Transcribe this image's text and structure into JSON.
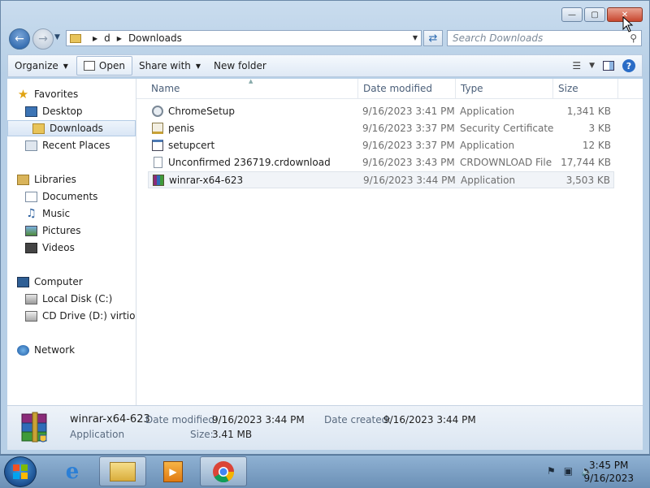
{
  "address": {
    "crumbs": [
      "d",
      "Downloads"
    ]
  },
  "search": {
    "placeholder": "Search Downloads"
  },
  "toolbar": {
    "organize": "Organize",
    "open": "Open",
    "share_with": "Share with",
    "new_folder": "New folder"
  },
  "nav": {
    "favorites": "Favorites",
    "desktop": "Desktop",
    "downloads": "Downloads",
    "recent_places": "Recent Places",
    "libraries": "Libraries",
    "documents": "Documents",
    "music": "Music",
    "pictures": "Pictures",
    "videos": "Videos",
    "computer": "Computer",
    "local_disk": "Local Disk (C:)",
    "cd_drive": "CD Drive (D:) virtio-w",
    "network": "Network"
  },
  "columns": {
    "name": "Name",
    "date": "Date modified",
    "type": "Type",
    "size": "Size"
  },
  "files": [
    {
      "name": "ChromeSetup",
      "date": "9/16/2023 3:41 PM",
      "type": "Application",
      "size": "1,341 KB",
      "icon": "chrome-setup-icon"
    },
    {
      "name": "penis",
      "date": "9/16/2023 3:37 PM",
      "type": "Security Certificate",
      "size": "3 KB",
      "icon": "certificate-icon"
    },
    {
      "name": "setupcert",
      "date": "9/16/2023 3:37 PM",
      "type": "Application",
      "size": "12 KB",
      "icon": "application-icon"
    },
    {
      "name": "Unconfirmed 236719.crdownload",
      "date": "9/16/2023 3:43 PM",
      "type": "CRDOWNLOAD File",
      "size": "17,744 KB",
      "icon": "blank-file-icon"
    },
    {
      "name": "winrar-x64-623",
      "date": "9/16/2023 3:44 PM",
      "type": "Application",
      "size": "3,503 KB",
      "icon": "winrar-icon"
    }
  ],
  "details": {
    "name": "winrar-x64-623",
    "type": "Application",
    "date_modified_label": "Date modified:",
    "date_modified": "9/16/2023 3:44 PM",
    "size_label": "Size:",
    "size": "3.41 MB",
    "date_created_label": "Date created:",
    "date_created": "9/16/2023 3:44 PM"
  },
  "clock": {
    "time": "3:45 PM",
    "date": "9/16/2023"
  }
}
